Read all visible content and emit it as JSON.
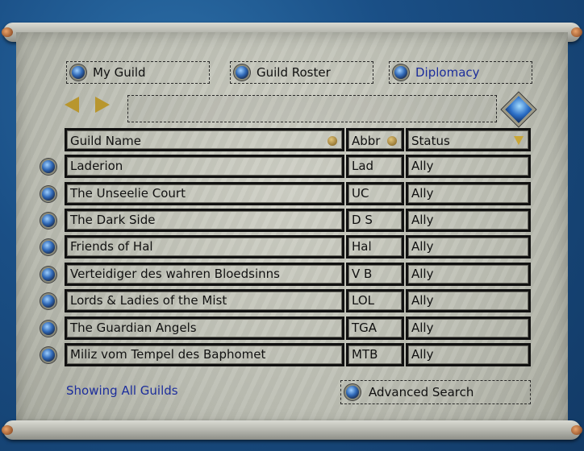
{
  "tabs": [
    {
      "label": "My Guild",
      "active": false
    },
    {
      "label": "Guild Roster",
      "active": false
    },
    {
      "label": "Diplomacy",
      "active": true
    }
  ],
  "table": {
    "headers": {
      "name": "Guild Name",
      "abbr": "Abbr",
      "status": "Status"
    },
    "rows": [
      {
        "name": "Laderion",
        "abbr": "Lad",
        "status": "Ally"
      },
      {
        "name": "The Unseelie Court",
        "abbr": "UC",
        "status": "Ally"
      },
      {
        "name": "The Dark Side",
        "abbr": "D S",
        "status": "Ally"
      },
      {
        "name": "Friends of Hal",
        "abbr": "Hal",
        "status": "Ally"
      },
      {
        "name": "Verteidiger des wahren Bloedsinns",
        "abbr": "V B",
        "status": "Ally"
      },
      {
        "name": "Lords & Ladies of the Mist",
        "abbr": "LOL",
        "status": "Ally"
      },
      {
        "name": "The Guardian Angels",
        "abbr": "TGA",
        "status": "Ally"
      },
      {
        "name": "Miliz vom Tempel des Baphomet",
        "abbr": "MTB",
        "status": "Ally"
      }
    ]
  },
  "footer": {
    "filter_text": "Showing All Guilds",
    "advanced_search_label": "Advanced Search"
  },
  "colors": {
    "accent_link": "#1d2e9c",
    "parchment": "#c4c5bb"
  }
}
